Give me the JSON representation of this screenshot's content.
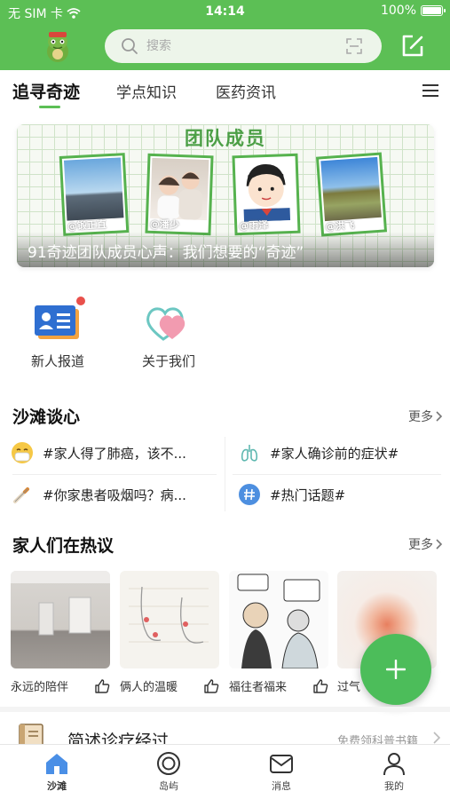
{
  "status_bar": {
    "carrier": "无 SIM 卡",
    "time": "14:14",
    "battery": "100%"
  },
  "colors": {
    "brand_green": "#5cbf55",
    "fab_green": "#4cbd5a",
    "red_dot": "#e9504b"
  },
  "header": {
    "search_placeholder": "搜索"
  },
  "tabs": [
    {
      "label": "追寻奇迹",
      "active": true
    },
    {
      "label": "学点知识",
      "active": false
    },
    {
      "label": "医药资讯",
      "active": false
    }
  ],
  "banner": {
    "title": "团队成员",
    "caption": "91奇迹团队成员心声：我们想要的“奇迹”",
    "members": [
      "@锻正直",
      "@潘少",
      "@雨泽",
      "@洪飞"
    ]
  },
  "quick_entries": [
    {
      "label": "新人报道",
      "icon": "id-card-icon",
      "has_badge": true
    },
    {
      "label": "关于我们",
      "icon": "hearts-icon",
      "has_badge": false
    }
  ],
  "beach_talk": {
    "title": "沙滩谈心",
    "more": "更多",
    "topics": [
      {
        "text": "#家人得了肺癌，该不...",
        "icon": "mask-face-icon"
      },
      {
        "text": "#家人确诊前的症状#",
        "icon": "lungs-icon"
      },
      {
        "text": "#你家患者吸烟吗？病...",
        "icon": "cigarette-icon"
      },
      {
        "text": "#热门话题#",
        "icon": "hashtag-icon"
      }
    ]
  },
  "hot_discussion": {
    "title": "家人们在热议",
    "more": "更多",
    "cards": [
      {
        "caption": "永远的陪伴"
      },
      {
        "caption": "俩人的温暖"
      },
      {
        "caption": "福往者福来"
      },
      {
        "caption": "过气"
      }
    ]
  },
  "brief": {
    "title": "简述诊疗经过",
    "subtitle": "免费领科普书籍"
  },
  "bottom_nav": [
    {
      "label": "沙滩",
      "active": true
    },
    {
      "label": "岛屿",
      "active": false
    },
    {
      "label": "消息",
      "active": false
    },
    {
      "label": "我的",
      "active": false
    }
  ]
}
